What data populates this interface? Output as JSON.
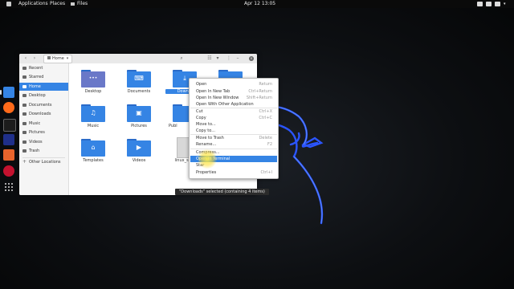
{
  "topbar": {
    "applications": "Applications",
    "places": "Places",
    "files": "Files",
    "datetime": "Apr 12  13:05"
  },
  "window": {
    "path": "Home",
    "sidebar": [
      {
        "label": "Recent",
        "icon": "clock-icon"
      },
      {
        "label": "Starred",
        "icon": "star-icon"
      },
      {
        "label": "Home",
        "icon": "home-icon",
        "active": true
      },
      {
        "label": "Desktop",
        "icon": "desktop-icon"
      },
      {
        "label": "Documents",
        "icon": "documents-icon"
      },
      {
        "label": "Downloads",
        "icon": "download-icon"
      },
      {
        "label": "Music",
        "icon": "music-icon"
      },
      {
        "label": "Pictures",
        "icon": "pictures-icon"
      },
      {
        "label": "Videos",
        "icon": "videos-icon"
      },
      {
        "label": "Trash",
        "icon": "trash-icon"
      },
      {
        "label": "Other Locations",
        "icon": "plus-icon"
      }
    ],
    "files": [
      {
        "name": "Desktop"
      },
      {
        "name": "Documents"
      },
      {
        "name": "Downlo"
      },
      {
        "name": "Music"
      },
      {
        "name": "Pictures"
      },
      {
        "name": "Publ"
      },
      {
        "name": "Templates"
      },
      {
        "name": "Videos"
      },
      {
        "name": "linux_sign"
      }
    ],
    "status": "\"Downloads\" selected (containing 4 items)"
  },
  "context_menu": [
    {
      "label": "Open",
      "shortcut": "Return"
    },
    {
      "label": "Open In New Tab",
      "shortcut": "Ctrl+Return"
    },
    {
      "label": "Open In New Window",
      "shortcut": "Shift+Return"
    },
    {
      "label": "Open With Other Application",
      "shortcut": ""
    },
    {
      "label": "Cut",
      "shortcut": "Ctrl+X"
    },
    {
      "label": "Copy",
      "shortcut": "Ctrl+C"
    },
    {
      "label": "Move to...",
      "shortcut": ""
    },
    {
      "label": "Copy to...",
      "shortcut": ""
    },
    {
      "label": "Move to Trash",
      "shortcut": "Delete"
    },
    {
      "label": "Rename...",
      "shortcut": "F2"
    },
    {
      "label": "Compress...",
      "shortcut": ""
    },
    {
      "label": "Open in Terminal",
      "shortcut": ""
    },
    {
      "label": "Star",
      "shortcut": ""
    },
    {
      "label": "Properties",
      "shortcut": "Ctrl+I"
    }
  ]
}
